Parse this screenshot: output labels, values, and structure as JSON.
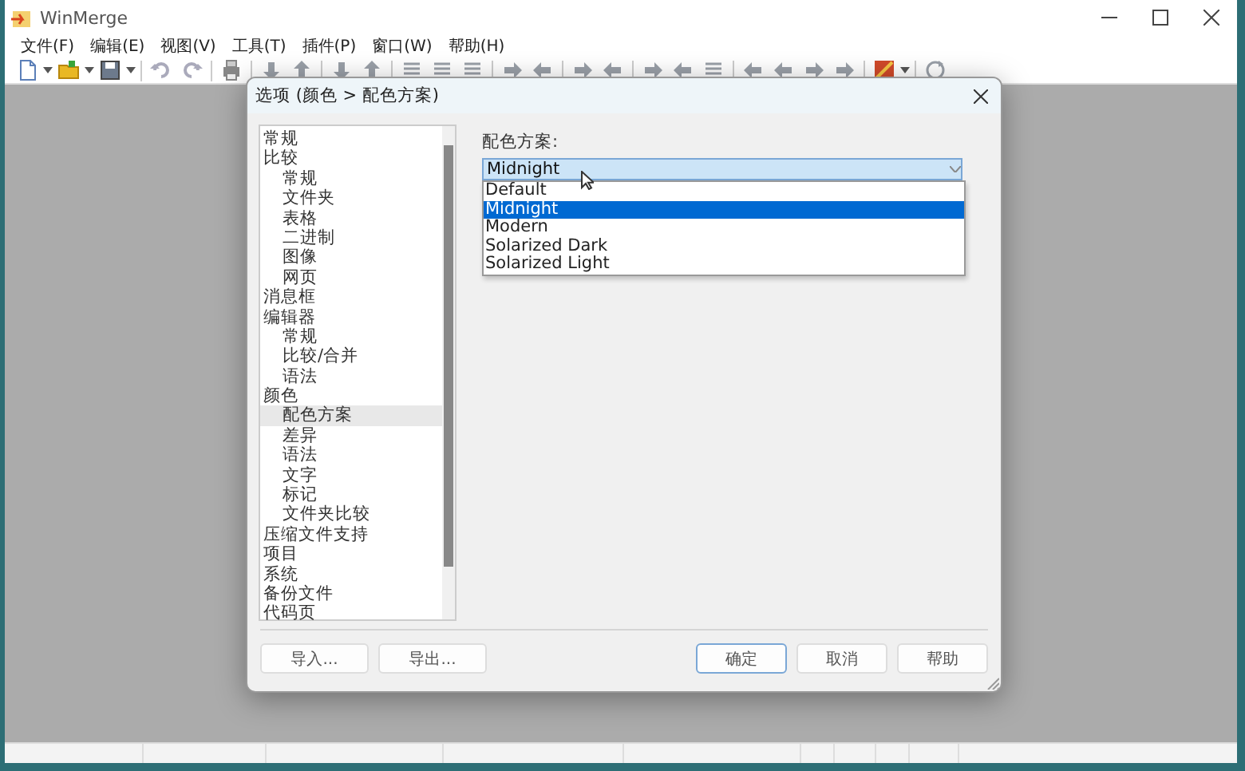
{
  "window": {
    "title": "WinMerge"
  },
  "menu": [
    {
      "label": "文件(F)"
    },
    {
      "label": "编辑(E)"
    },
    {
      "label": "视图(V)"
    },
    {
      "label": "工具(T)"
    },
    {
      "label": "插件(P)"
    },
    {
      "label": "窗口(W)"
    },
    {
      "label": "帮助(H)"
    }
  ],
  "dialog": {
    "title": "选项 (颜色 > 配色方案)",
    "tree": [
      {
        "label": "常规",
        "selected": false
      },
      {
        "label": "比较",
        "selected": false,
        "children": [
          {
            "label": "常规",
            "selected": false
          },
          {
            "label": "文件夹",
            "selected": false
          },
          {
            "label": "表格",
            "selected": false
          },
          {
            "label": "二进制",
            "selected": false
          },
          {
            "label": "图像",
            "selected": false
          },
          {
            "label": "网页",
            "selected": false
          }
        ]
      },
      {
        "label": "消息框",
        "selected": false
      },
      {
        "label": "编辑器",
        "selected": false,
        "children": [
          {
            "label": "常规",
            "selected": false
          },
          {
            "label": "比较/合并",
            "selected": false
          },
          {
            "label": "语法",
            "selected": false
          }
        ]
      },
      {
        "label": "颜色",
        "selected": false,
        "children": [
          {
            "label": "配色方案",
            "selected": true
          },
          {
            "label": "差异",
            "selected": false
          },
          {
            "label": "语法",
            "selected": false
          },
          {
            "label": "文字",
            "selected": false
          },
          {
            "label": "标记",
            "selected": false
          },
          {
            "label": "文件夹比较",
            "selected": false
          }
        ]
      },
      {
        "label": "压缩文件支持",
        "selected": false
      },
      {
        "label": "项目",
        "selected": false
      },
      {
        "label": "系统",
        "selected": false
      },
      {
        "label": "备份文件",
        "selected": false
      },
      {
        "label": "代码页",
        "selected": false
      }
    ],
    "color_scheme": {
      "label": "配色方案:",
      "value": "Midnight",
      "expanded": true,
      "options": [
        {
          "label": "Default",
          "selected": false
        },
        {
          "label": "Midnight",
          "selected": true
        },
        {
          "label": "Modern",
          "selected": false
        },
        {
          "label": "Solarized Dark",
          "selected": false
        },
        {
          "label": "Solarized Light",
          "selected": false
        }
      ]
    },
    "left_buttons": [
      {
        "label": "导入...",
        "default": false
      },
      {
        "label": "导出...",
        "default": false
      }
    ],
    "right_buttons": [
      {
        "label": "确定",
        "default": true
      },
      {
        "label": "取消",
        "default": false
      },
      {
        "label": "帮助",
        "default": false
      }
    ]
  }
}
